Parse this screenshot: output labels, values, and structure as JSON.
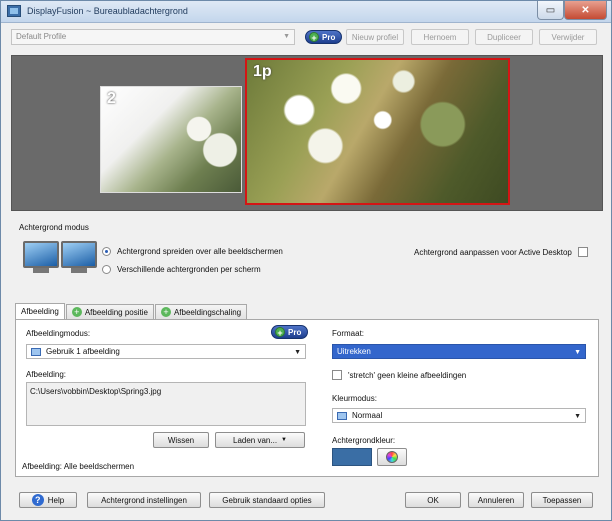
{
  "window": {
    "title": "DisplayFusion ~ Bureaubladachtergrond",
    "restore_glyph": "▭",
    "close_glyph": "✕"
  },
  "toolbar": {
    "profile_value": "Default Profile",
    "pro_label": "Pro",
    "new_profile_label": "Nieuw profiel",
    "rename_label": "Hernoem",
    "duplicate_label": "Dupliceer",
    "delete_label": "Verwijder"
  },
  "preview": {
    "monitors": [
      {
        "label": "2"
      },
      {
        "label": "1p"
      }
    ],
    "selected_border_color": "#d41515"
  },
  "mode": {
    "group_title": "Achtergrond modus",
    "options": [
      {
        "label": "Achtergrond spreiden over alle beeldschermen",
        "selected": true
      },
      {
        "label": "Verschillende achtergronden per scherm",
        "selected": false
      }
    ],
    "active_desktop_label": "Achtergrond aanpassen voor Active Desktop"
  },
  "tabs": [
    {
      "label": "Afbeelding",
      "active": true,
      "icon": null
    },
    {
      "label": "Afbeelding positie",
      "active": false,
      "icon": "plus-icon"
    },
    {
      "label": "Afbeeldingschaling",
      "active": false,
      "icon": "plus-icon"
    }
  ],
  "image_tab": {
    "mode_label": "Afbeeldingmodus:",
    "pro_label": "Pro",
    "mode_value": "Gebruik 1 afbeelding",
    "image_label": "Afbeelding:",
    "image_path": "C:\\Users\\vobbin\\Desktop\\Spring3.jpg",
    "clear_label": "Wissen",
    "load_label": "Laden van...",
    "footer_text": "Afbeelding: Alle beeldschermen",
    "format_label": "Formaat:",
    "format_value": "Uitrekken",
    "stretch_label": "'stretch' geen kleine afbeeldingen",
    "color_mode_label": "Kleurmodus:",
    "color_mode_value": "Normaal",
    "bg_color_label": "Achtergrondkleur:",
    "bg_color": "#3a6ea5"
  },
  "bottom": {
    "help_label": "Help",
    "bg_settings_label": "Achtergrond instellingen",
    "defaults_label": "Gebruik standaard opties",
    "ok_label": "OK",
    "cancel_label": "Annuleren",
    "apply_label": "Toepassen"
  }
}
